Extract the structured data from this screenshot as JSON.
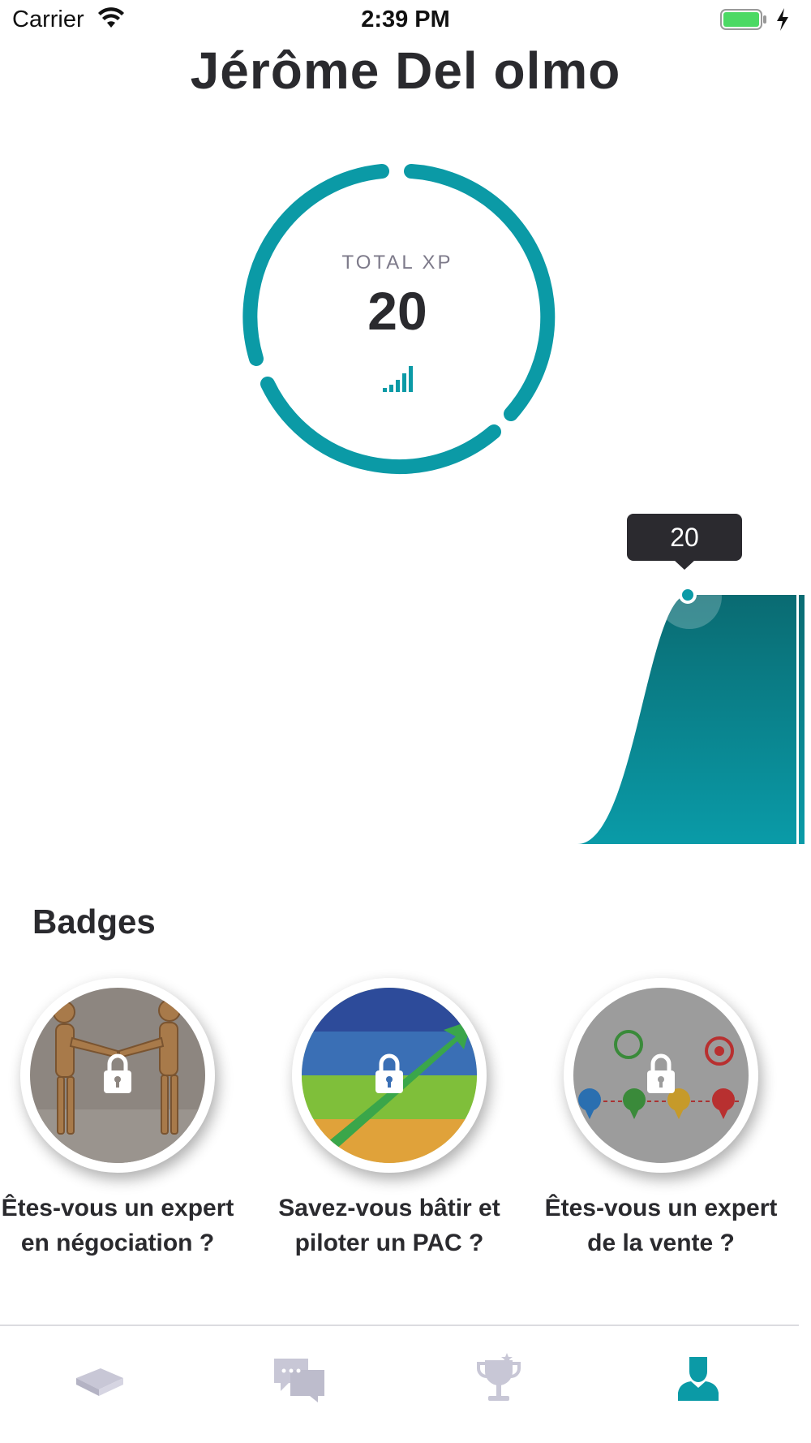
{
  "status_bar": {
    "carrier": "Carrier",
    "time": "2:39 PM",
    "battery_color": "#4cd964"
  },
  "profile": {
    "name": "Jérôme Del olmo"
  },
  "xp": {
    "label": "TOTAL XP",
    "value": "20",
    "ring_color": "#0b9aa6",
    "level_icon": "signal-bars-icon"
  },
  "chart_data": {
    "type": "area",
    "series": [
      {
        "values": [
          0,
          20
        ]
      }
    ],
    "highlighted_value": "20",
    "fill_color_top": "#0a6b72",
    "fill_color_bottom": "#0a9ba8"
  },
  "badges": {
    "title": "Badges",
    "items": [
      {
        "title": "Êtes-vous un expert en négociation ?",
        "locked": true,
        "image": "wooden-mannequins-handshake"
      },
      {
        "title": "Savez-vous bâtir et piloter un PAC ?",
        "locked": true,
        "image": "vision-plan-action-success"
      },
      {
        "title": "Êtes-vous un expert de la vente ?",
        "locked": true,
        "image": "plan-for-success"
      }
    ]
  },
  "tab_bar": {
    "tabs": [
      {
        "icon": "book-icon",
        "active": false
      },
      {
        "icon": "chat-icon",
        "active": false
      },
      {
        "icon": "trophy-icon",
        "active": false
      },
      {
        "icon": "profile-icon",
        "active": true
      }
    ],
    "active_color": "#0b9aa6",
    "inactive_color": "#c8c7d6"
  }
}
